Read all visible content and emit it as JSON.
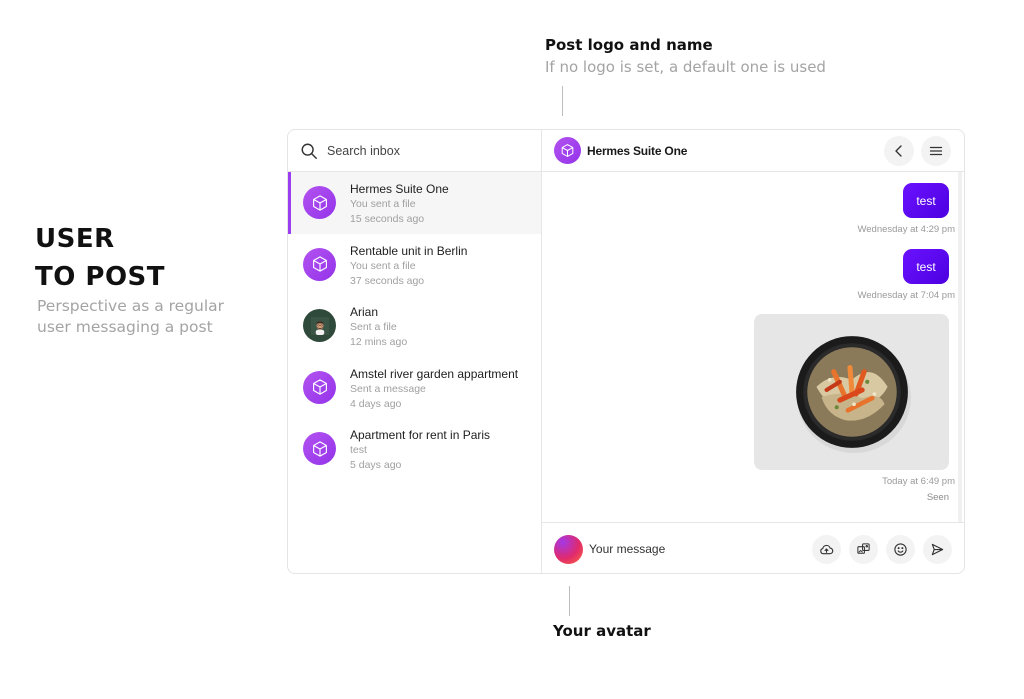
{
  "hero": {
    "title_line1": "USER",
    "title_line2": "TO POST",
    "subtitle": "Perspective as a regular user messaging a post"
  },
  "annotations": {
    "top_title": "Post logo and name",
    "top_subtitle": "If no logo is set, a default one is used",
    "bottom_title": "Your avatar"
  },
  "search": {
    "placeholder": "Search inbox",
    "icon": "search-icon"
  },
  "conversations": [
    {
      "name": "Hermes Suite One",
      "last_message": "You sent a file",
      "time": "15 seconds ago",
      "avatar": "cube-icon",
      "active": true
    },
    {
      "name": "Rentable unit in Berlin",
      "last_message": "You sent a file",
      "time": "37 seconds ago",
      "avatar": "cube-icon",
      "active": false
    },
    {
      "name": "Arian",
      "last_message": "Sent a file",
      "time": "12 mins ago",
      "avatar": "user-photo",
      "active": false
    },
    {
      "name": "Amstel river garden appartment",
      "last_message": "Sent a message",
      "time": "4 days ago",
      "avatar": "cube-icon",
      "active": false
    },
    {
      "name": "Apartment for rent in Paris",
      "last_message": "test",
      "time": "5 days ago",
      "avatar": "cube-icon",
      "active": false
    }
  ],
  "chat": {
    "title": "Hermes Suite One",
    "header_icons": [
      "chevron-left-icon",
      "hamburger-menu-icon"
    ],
    "messages": [
      {
        "type": "text",
        "text": "test",
        "timestamp": "Wednesday at 4:29 pm"
      },
      {
        "type": "text",
        "text": "test",
        "timestamp": "Wednesday at 7:04 pm"
      },
      {
        "type": "image",
        "description": "food-bowl-image",
        "timestamp": "Today at 6:49 pm"
      }
    ],
    "seen_label": "Seen"
  },
  "composer": {
    "placeholder": "Your message",
    "icons": [
      "cloud-upload-icon",
      "gallery-icon",
      "emoji-icon",
      "send-icon"
    ]
  },
  "colors": {
    "accent_purple": "#9b3df0",
    "bubble_blue": "#5a0af0",
    "muted_text": "#a0a0a0"
  }
}
